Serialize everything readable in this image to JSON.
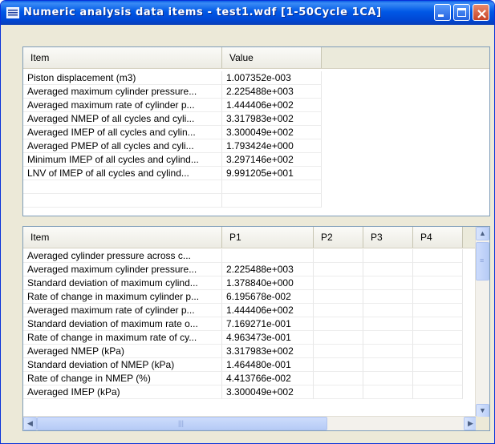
{
  "window": {
    "title": "Numeric analysis data items - test1.wdf [1-50Cycle 1CA]",
    "controls": {
      "minimize": "minimize",
      "maximize": "maximize",
      "close": "close"
    }
  },
  "summary_table": {
    "columns": [
      "Item",
      "Value"
    ],
    "rows": [
      [
        "Piston displacement (m3)",
        "1.007352e-003"
      ],
      [
        "Averaged maximum cylinder pressure...",
        "2.225488e+003"
      ],
      [
        "Averaged maximum rate of cylinder p...",
        "1.444406e+002"
      ],
      [
        "Averaged NMEP of all cycles and cyli...",
        "3.317983e+002"
      ],
      [
        "Averaged IMEP of all cycles and cylin...",
        "3.300049e+002"
      ],
      [
        "Averaged PMEP of all cycles and cyli...",
        "1.793424e+000"
      ],
      [
        "Minimum IMEP of all cycles and cylind...",
        "3.297146e+002"
      ],
      [
        "LNV of IMEP of  all cycles and cylind...",
        "9.991205e+001"
      ]
    ]
  },
  "cylinder_table": {
    "columns": [
      "Item",
      "P1",
      "P2",
      "P3",
      "P4"
    ],
    "rows": [
      [
        "Averaged cylinder pressure across c...",
        ""
      ],
      [
        "Averaged maximum cylinder pressure...",
        "2.225488e+003"
      ],
      [
        "Standard deviation of maximum cylind...",
        "1.378840e+000"
      ],
      [
        "Rate of change in maximum cylinder p...",
        "6.195678e-002"
      ],
      [
        "Averaged maximum rate of cylinder p...",
        "1.444406e+002"
      ],
      [
        "Standard deviation of maximum rate o...",
        "7.169271e-001"
      ],
      [
        "Rate of change in maximum rate of cy...",
        "4.963473e-001"
      ],
      [
        "Averaged NMEP (kPa)",
        "3.317983e+002"
      ],
      [
        "Standard deviation of NMEP (kPa)",
        "1.464480e-001"
      ],
      [
        "Rate of change in NMEP (%)",
        "4.413766e-002"
      ],
      [
        "Averaged IMEP (kPa)",
        "3.300049e+002"
      ]
    ]
  },
  "icons": {
    "app": "list-window-icon",
    "scroll_up": "arrow-up-icon",
    "scroll_down": "arrow-down-icon",
    "scroll_left": "arrow-left-icon",
    "scroll_right": "arrow-right-icon"
  },
  "colors": {
    "titlebar": "#0058e6",
    "close_button": "#c84326",
    "border": "#7f9db9",
    "header": "#ebeadb"
  }
}
